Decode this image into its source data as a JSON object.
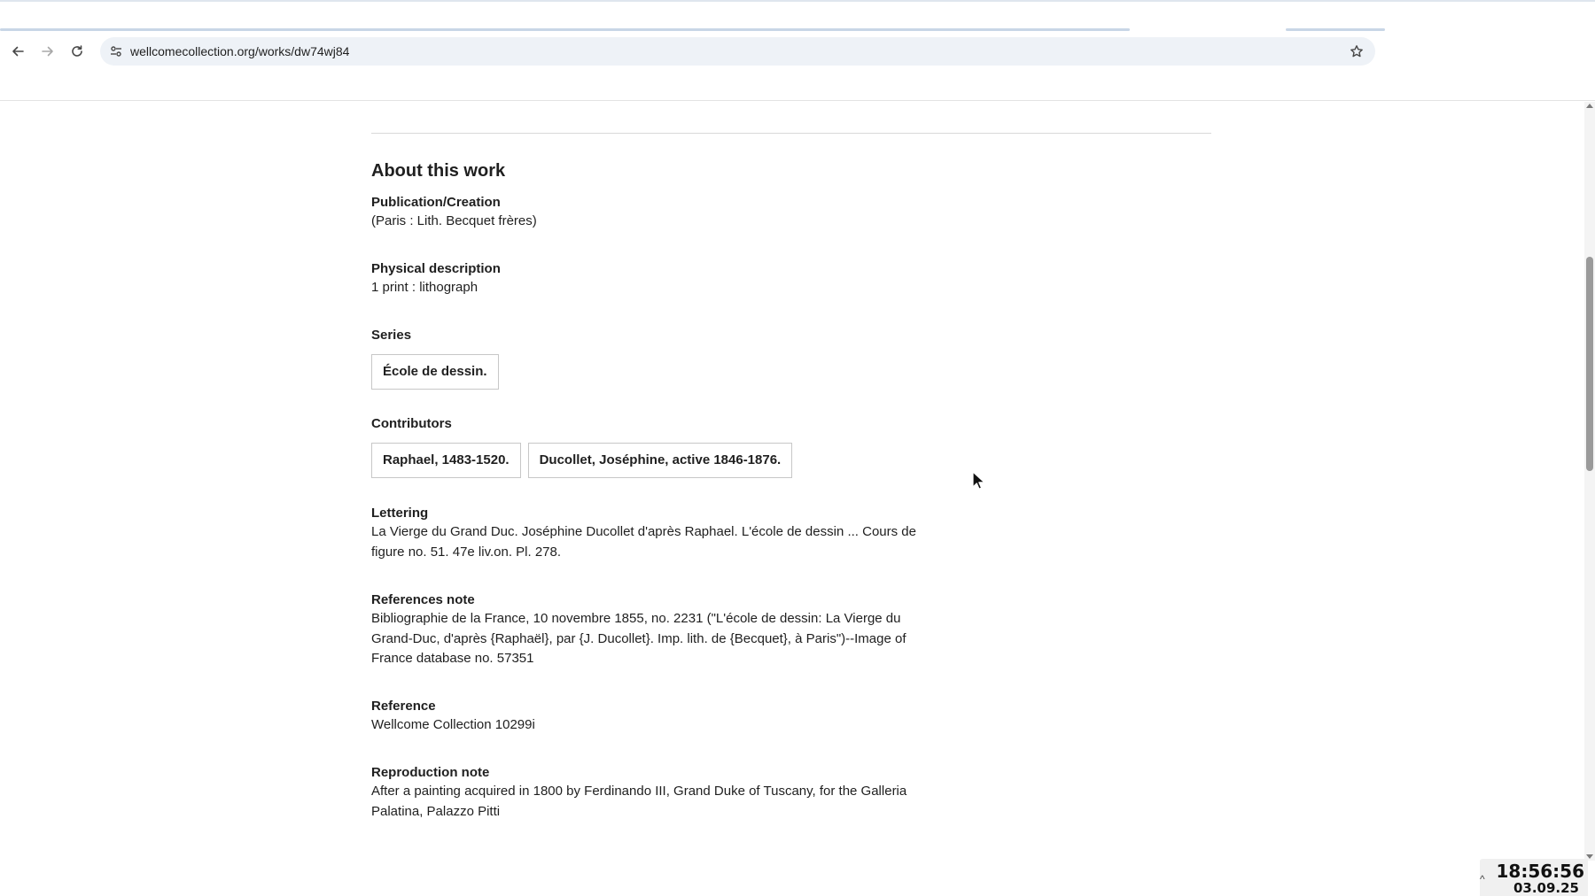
{
  "browser": {
    "url": "wellcomecollection.org/works/dw74wj84"
  },
  "work": {
    "section_title": "About this work",
    "publication": {
      "label": "Publication/Creation",
      "value": "(Paris : Lith. Becquet frères)"
    },
    "physical": {
      "label": "Physical description",
      "value": "1 print : lithograph"
    },
    "series": {
      "label": "Series",
      "items": [
        "École de dessin."
      ]
    },
    "contributors": {
      "label": "Contributors",
      "items": [
        "Raphael, 1483-1520.",
        "Ducollet, Joséphine, active 1846-1876."
      ]
    },
    "lettering": {
      "label": "Lettering",
      "lines": [
        "La Vierge du Grand Duc. Joséphine Ducollet d'après Raphael. L'école de dessin ... Cours de",
        "figure no. 51. 47e liv.on. Pl. 278."
      ]
    },
    "references_note": {
      "label": "References note",
      "lines": [
        "Bibliographie de la France, 10 novembre 1855, no. 2231 (\"L'école de dessin: La Vierge du",
        "Grand-Duc, d'après {Raphaël}, par {J. Ducollet}. Imp. lith. de {Becquet}, à Paris\")--Image of",
        "France database no. 57351"
      ]
    },
    "reference": {
      "label": "Reference",
      "value": "Wellcome Collection 10299i"
    },
    "reproduction_note": {
      "label": "Reproduction note",
      "lines": [
        "After a painting acquired in 1800 by Ferdinando III, Grand Duke of Tuscany, for the Galleria",
        "Palatina, Palazzo Pitti"
      ]
    }
  },
  "clock": {
    "time": "18:56:56",
    "date": "03.09.25"
  }
}
